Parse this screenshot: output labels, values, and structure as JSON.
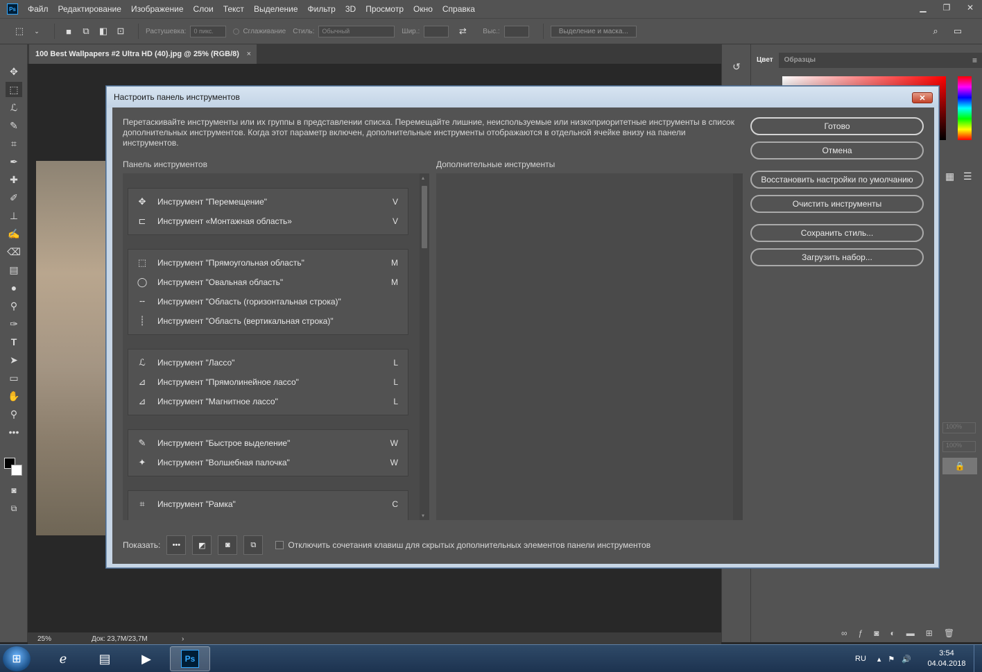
{
  "menubar": {
    "logo": "Ps",
    "items": [
      "Файл",
      "Редактирование",
      "Изображение",
      "Слои",
      "Текст",
      "Выделение",
      "Фильтр",
      "3D",
      "Просмотр",
      "Окно",
      "Справка"
    ]
  },
  "optbar": {
    "feather_label": "Растушевка:",
    "feather_value": "0 пикс.",
    "antialias_label": "Сглаживание",
    "style_label": "Стиль:",
    "style_value": "Обычный",
    "width_label": "Шир.:",
    "height_label": "Выс.:",
    "mask_button": "Выделение и маска..."
  },
  "document": {
    "tab_title": "100 Best Wallpapers #2 Ultra HD (40).jpg @ 25% (RGB/8)",
    "close": "×",
    "zoom": "25%",
    "doc_size": "Док: 23,7M/23,7M",
    "arrow": "›"
  },
  "right_panel": {
    "tab_color": "Цвет",
    "tab_swatches": "Образцы",
    "opacity1": "100%",
    "opacity2": "100%"
  },
  "dialog": {
    "title": "Настроить панель инструментов",
    "close": "✕",
    "description": "Перетаскивайте инструменты или их группы в представлении списка. Перемещайте лишние, неиспользуемые или низкоприоритетные инструменты в список дополнительных инструментов. Когда этот параметр включен, дополнительные инструменты отображаются в отдельной ячейке внизу на панели инструментов.",
    "col_toolbar": "Панель инструментов",
    "col_extra": "Дополнительные инструменты",
    "btn_done": "Готово",
    "btn_cancel": "Отмена",
    "btn_restore": "Восстановить настройки по умолчанию",
    "btn_clear": "Очистить инструменты",
    "btn_save": "Сохранить стиль...",
    "btn_load": "Загрузить набор...",
    "show_label": "Показать:",
    "checkbox_label": "Отключить сочетания клавиш для скрытых дополнительных элементов панели инструментов",
    "groups": [
      {
        "rows": [
          {
            "icon": "✥",
            "label": "Инструмент \"Перемещение\"",
            "key": "V"
          },
          {
            "icon": "⊏",
            "label": "Инструмент «Монтажная область»",
            "key": "V"
          }
        ]
      },
      {
        "rows": [
          {
            "icon": "⬚",
            "label": "Инструмент \"Прямоугольная область\"",
            "key": "M"
          },
          {
            "icon": "◯",
            "label": "Инструмент \"Овальная область\"",
            "key": "M"
          },
          {
            "icon": "╌",
            "label": "Инструмент \"Область (горизонтальная строка)\"",
            "key": ""
          },
          {
            "icon": "┊",
            "label": "Инструмент \"Область (вертикальная строка)\"",
            "key": ""
          }
        ]
      },
      {
        "rows": [
          {
            "icon": "ℒ",
            "label": "Инструмент \"Лассо\"",
            "key": "L"
          },
          {
            "icon": "⊿",
            "label": "Инструмент \"Прямолинейное лассо\"",
            "key": "L"
          },
          {
            "icon": "⊿",
            "label": "Инструмент \"Магнитное лассо\"",
            "key": "L"
          }
        ]
      },
      {
        "rows": [
          {
            "icon": "✎",
            "label": "Инструмент \"Быстрое выделение\"",
            "key": "W"
          },
          {
            "icon": "✦",
            "label": "Инструмент \"Волшебная палочка\"",
            "key": "W"
          }
        ]
      },
      {
        "rows": [
          {
            "icon": "⌗",
            "label": "Инструмент \"Рамка\"",
            "key": "C"
          }
        ]
      }
    ]
  },
  "taskbar": {
    "lang": "RU",
    "time": "3:54",
    "date": "04.04.2018",
    "ps_label": "Ps"
  }
}
